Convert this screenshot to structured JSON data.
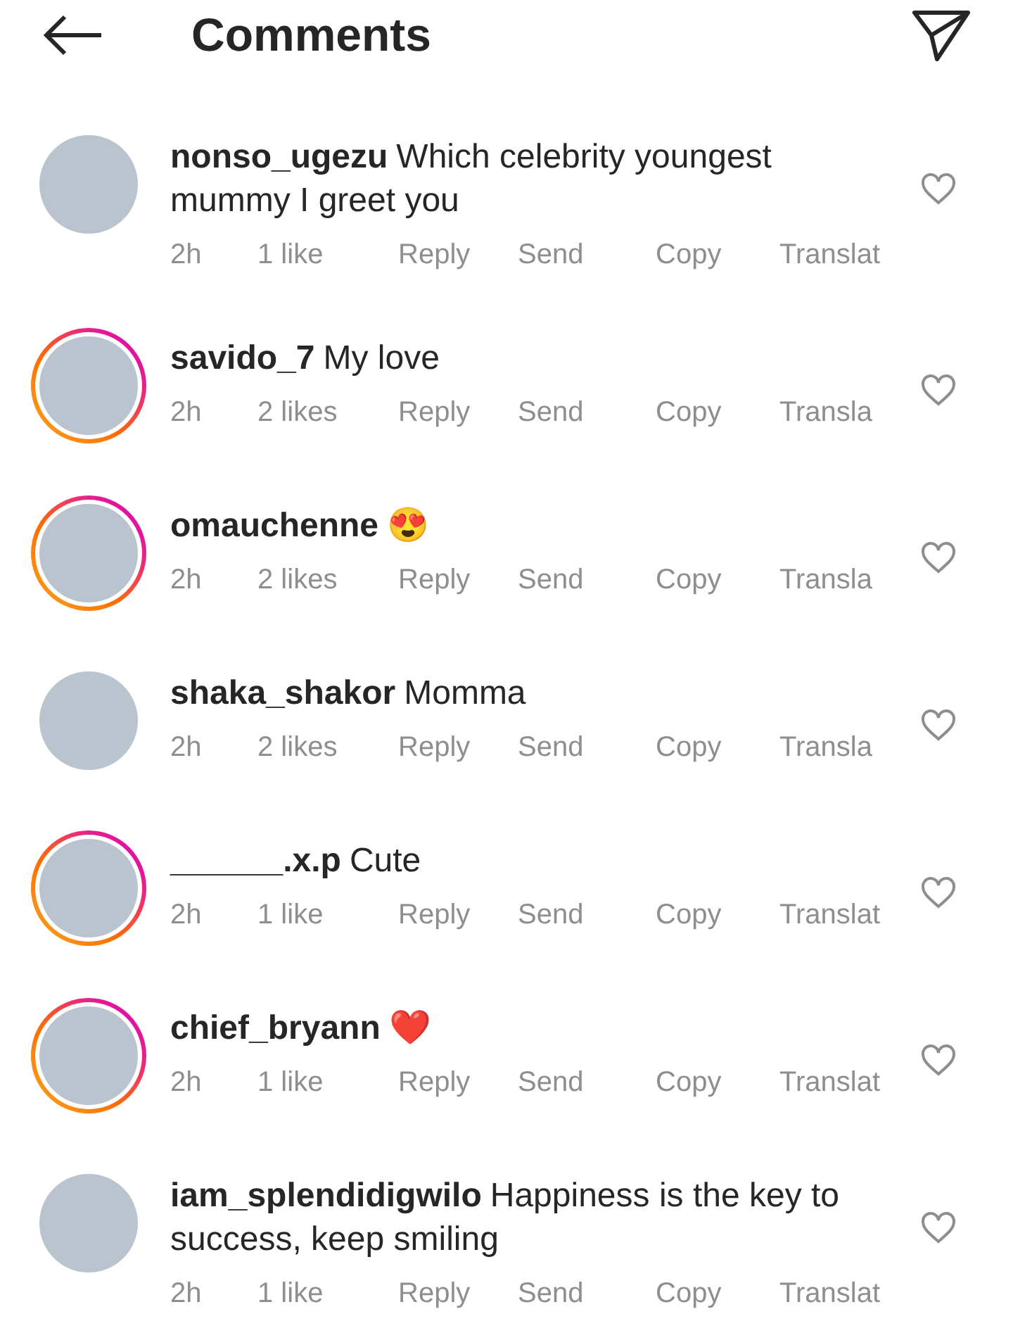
{
  "header": {
    "title": "Comments"
  },
  "comments": [
    {
      "username": "nonso_ugezu",
      "text": "Which celebrity youngest mummy I greet you",
      "story": false,
      "time": "2h",
      "likes": "1 like",
      "actions": [
        "Reply",
        "Send",
        "Copy",
        "Translat"
      ],
      "liked": false
    },
    {
      "username": "savido_7",
      "text": "My love",
      "story": true,
      "time": "2h",
      "likes": "2 likes",
      "actions": [
        "Reply",
        "Send",
        "Copy",
        "Transla"
      ],
      "liked": false
    },
    {
      "username": "omauchenne",
      "text": "😍",
      "story": true,
      "time": "2h",
      "likes": "2 likes",
      "actions": [
        "Reply",
        "Send",
        "Copy",
        "Transla"
      ],
      "liked": false
    },
    {
      "username": "shaka_shakor",
      "text": "Momma",
      "story": false,
      "time": "2h",
      "likes": "2 likes",
      "actions": [
        "Reply",
        "Send",
        "Copy",
        "Transla"
      ],
      "liked": false
    },
    {
      "username": "______.x.p",
      "text": "Cute",
      "story": true,
      "time": "2h",
      "likes": "1 like",
      "actions": [
        "Reply",
        "Send",
        "Copy",
        "Translat"
      ],
      "liked": false
    },
    {
      "username": "chief_bryann",
      "text": "❤️",
      "story": true,
      "time": "2h",
      "likes": "1 like",
      "actions": [
        "Reply",
        "Send",
        "Copy",
        "Translat"
      ],
      "liked": false
    },
    {
      "username": "iam_splendidigwilo",
      "text": "Happiness is the key to success, keep smiling",
      "story": false,
      "time": "2h",
      "likes": "1 like",
      "actions": [
        "Reply",
        "Send",
        "Copy",
        "Translat"
      ],
      "liked": false
    }
  ]
}
